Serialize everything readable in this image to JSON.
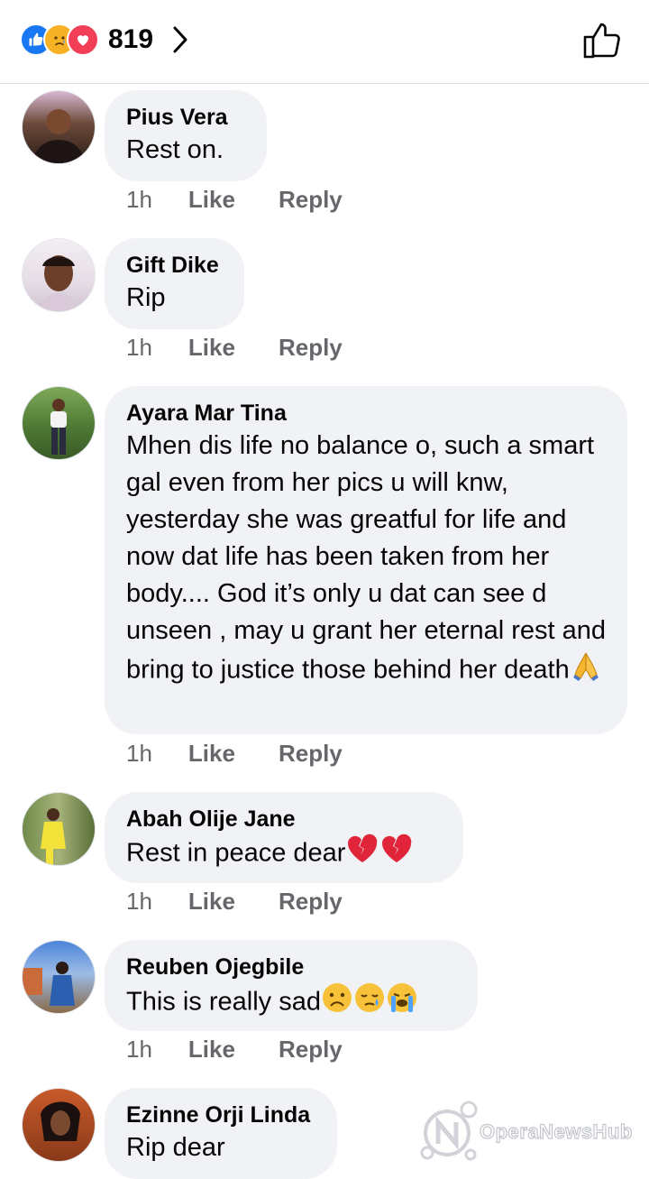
{
  "header": {
    "reaction_icons": [
      "like-icon",
      "sad-icon",
      "love-icon"
    ],
    "reaction_count": "819",
    "chevron_icon": "chevron-right-icon",
    "like_button_icon": "thumbs-up-outline-icon"
  },
  "comments": [
    {
      "name": "Pius Vera",
      "text": "Rest on.",
      "time": "1h",
      "like": "Like",
      "reply": "Reply"
    },
    {
      "name": "Gift Dike",
      "text": "Rip",
      "time": "1h",
      "like": "Like",
      "reply": "Reply"
    },
    {
      "name": "Ayara Mar Tina",
      "text": "Mhen dis life no balance o, such a smart gal even from her pics u will knw, yesterday she was greatful for life and now dat life has been taken from her body.... God it’s only u dat can see d unseen , may u grant her eternal rest and bring to justice those behind her death",
      "time": "1h",
      "like": "Like",
      "reply": "Reply"
    },
    {
      "name": "Abah Olije Jane",
      "text": "Rest in peace dear",
      "time": "1h",
      "like": "Like",
      "reply": "Reply"
    },
    {
      "name": "Reuben Ojegbile",
      "text": "This is really sad",
      "time": "1h",
      "like": "Like",
      "reply": "Reply"
    },
    {
      "name": "Ezinne Orji Linda",
      "text": "Rip dear"
    }
  ],
  "watermark": {
    "text": "OperaNewsHub",
    "icon": "opera-news-logo-icon"
  },
  "colors": {
    "like_blue": "#1877f2",
    "bubble_bg": "#f0f2f5",
    "meta_gray": "#65676b"
  }
}
